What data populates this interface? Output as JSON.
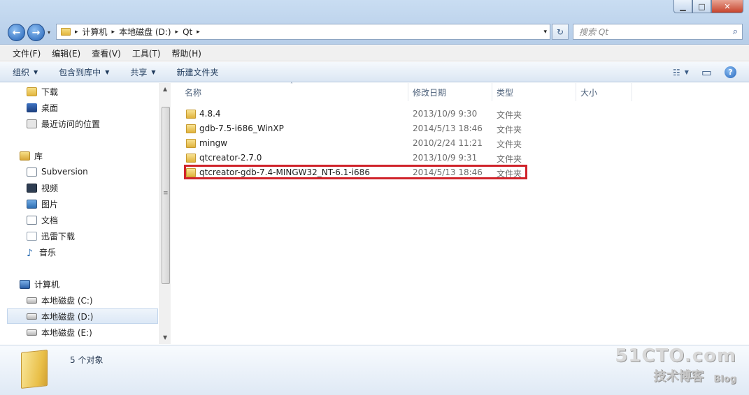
{
  "window": {
    "minimize": "▁",
    "maximize": "□",
    "close": "✕"
  },
  "nav": {
    "back_glyph": "←",
    "forward_glyph": "→",
    "history_glyph": "▾"
  },
  "address": {
    "breadcrumbs": [
      "计算机",
      "本地磁盘 (D:)",
      "Qt"
    ],
    "separator": "▸",
    "refresh_glyph": "↻",
    "dropdown_glyph": "▾"
  },
  "search": {
    "placeholder": "搜索 Qt",
    "icon": "search-icon",
    "icon_glyph": "⌕"
  },
  "menubar": [
    "文件(F)",
    "编辑(E)",
    "查看(V)",
    "工具(T)",
    "帮助(H)"
  ],
  "toolbar": {
    "organize": "组织",
    "include_library": "包含到库中",
    "share": "共享",
    "new_folder": "新建文件夹",
    "dropdown_glyph": "▼",
    "view_glyph": "☷",
    "preview_glyph": "▭",
    "help_glyph": "?"
  },
  "navpane": {
    "items": [
      {
        "label": "下载",
        "icon": "download-folder-icon"
      },
      {
        "label": "桌面",
        "icon": "desktop-icon"
      },
      {
        "label": "最近访问的位置",
        "icon": "recent-places-icon"
      },
      {
        "label": "库",
        "icon": "libraries-icon"
      },
      {
        "label": "Subversion",
        "icon": "document-library-icon"
      },
      {
        "label": "视频",
        "icon": "videos-icon"
      },
      {
        "label": "图片",
        "icon": "pictures-icon"
      },
      {
        "label": "文档",
        "icon": "documents-icon"
      },
      {
        "label": "迅雷下载",
        "icon": "thunder-download-icon"
      },
      {
        "label": "音乐",
        "icon": "music-icon"
      },
      {
        "label": "计算机",
        "icon": "computer-icon"
      },
      {
        "label": "本地磁盘 (C:)",
        "icon": "drive-icon"
      },
      {
        "label": "本地磁盘 (D:)",
        "icon": "drive-icon",
        "selected": true
      },
      {
        "label": "本地磁盘 (E:)",
        "icon": "drive-icon"
      }
    ],
    "scroll_up": "▲",
    "scroll_down": "▼",
    "scroll_grip": "≡"
  },
  "columns": {
    "name": "名称",
    "date": "修改日期",
    "type": "类型",
    "size": "大小",
    "sort_glyph": "˄"
  },
  "files": [
    {
      "name": "4.8.4",
      "date": "2013/10/9 9:30",
      "type": "文件夹"
    },
    {
      "name": "gdb-7.5-i686_WinXP",
      "date": "2014/5/13 18:46",
      "type": "文件夹"
    },
    {
      "name": "mingw",
      "date": "2010/2/24 11:21",
      "type": "文件夹"
    },
    {
      "name": "qtcreator-2.7.0",
      "date": "2013/10/9 9:31",
      "type": "文件夹"
    },
    {
      "name": "qtcreator-gdb-7.4-MINGW32_NT-6.1-i686",
      "date": "2014/5/13 18:46",
      "type": "文件夹",
      "highlighted": true
    }
  ],
  "details": {
    "count": "5 个对象"
  },
  "watermark": {
    "logo": "51CTO.com",
    "sub": "技术博客",
    "blog": "Blog"
  },
  "colors": {
    "highlight_border": "#d0232b",
    "folder": "#e3b63f",
    "nav_selected": "#dce8f6"
  }
}
